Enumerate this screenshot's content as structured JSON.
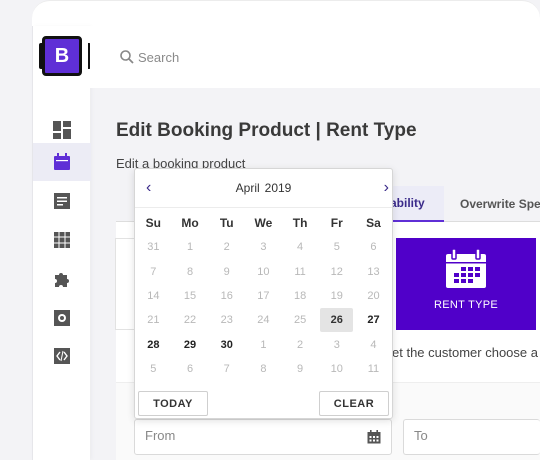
{
  "app": {
    "logo_letter": "B"
  },
  "search": {
    "placeholder": "Search"
  },
  "sidebar": {
    "items": [
      {
        "name": "dashboard-icon",
        "active": false
      },
      {
        "name": "calendar-icon",
        "active": true
      },
      {
        "name": "document-icon",
        "active": false
      },
      {
        "name": "grid-icon",
        "active": false
      },
      {
        "name": "puzzle-icon",
        "active": false
      },
      {
        "name": "settings-icon",
        "active": false
      },
      {
        "name": "code-icon",
        "active": false
      }
    ]
  },
  "page": {
    "title": "Edit Booking Product | Rent Type",
    "subtitle": "Edit a booking product"
  },
  "tabs": [
    {
      "label": "ability",
      "active": true
    },
    {
      "label": "Overwrite Spec",
      "active": false
    }
  ],
  "rent_type": {
    "label": "RENT TYPE"
  },
  "hint": {
    "text": "et the customer choose a s"
  },
  "range": {
    "from_placeholder": "From",
    "to_placeholder": "To"
  },
  "datepicker": {
    "month": "April",
    "year": "2019",
    "prev_symbol": "‹",
    "next_symbol": "›",
    "weekdays": [
      "Su",
      "Mo",
      "Tu",
      "We",
      "Th",
      "Fr",
      "Sa"
    ],
    "weeks": [
      [
        "31",
        "1",
        "2",
        "3",
        "4",
        "5",
        "6"
      ],
      [
        "7",
        "8",
        "9",
        "10",
        "11",
        "12",
        "13"
      ],
      [
        "14",
        "15",
        "16",
        "17",
        "18",
        "19",
        "20"
      ],
      [
        "21",
        "22",
        "23",
        "24",
        "25",
        "26",
        "27"
      ],
      [
        "28",
        "29",
        "30",
        "1",
        "2",
        "3",
        "4"
      ],
      [
        "5",
        "6",
        "7",
        "8",
        "9",
        "10",
        "11"
      ]
    ],
    "selected_day": "26",
    "enabled_days": [
      "26",
      "27",
      "28",
      "29",
      "30"
    ],
    "today_label": "TODAY",
    "clear_label": "CLEAR"
  },
  "colors": {
    "accent": "#5f2fd6",
    "rent_type_bg": "#5000c9",
    "active_tab_bg": "#ececf7"
  }
}
